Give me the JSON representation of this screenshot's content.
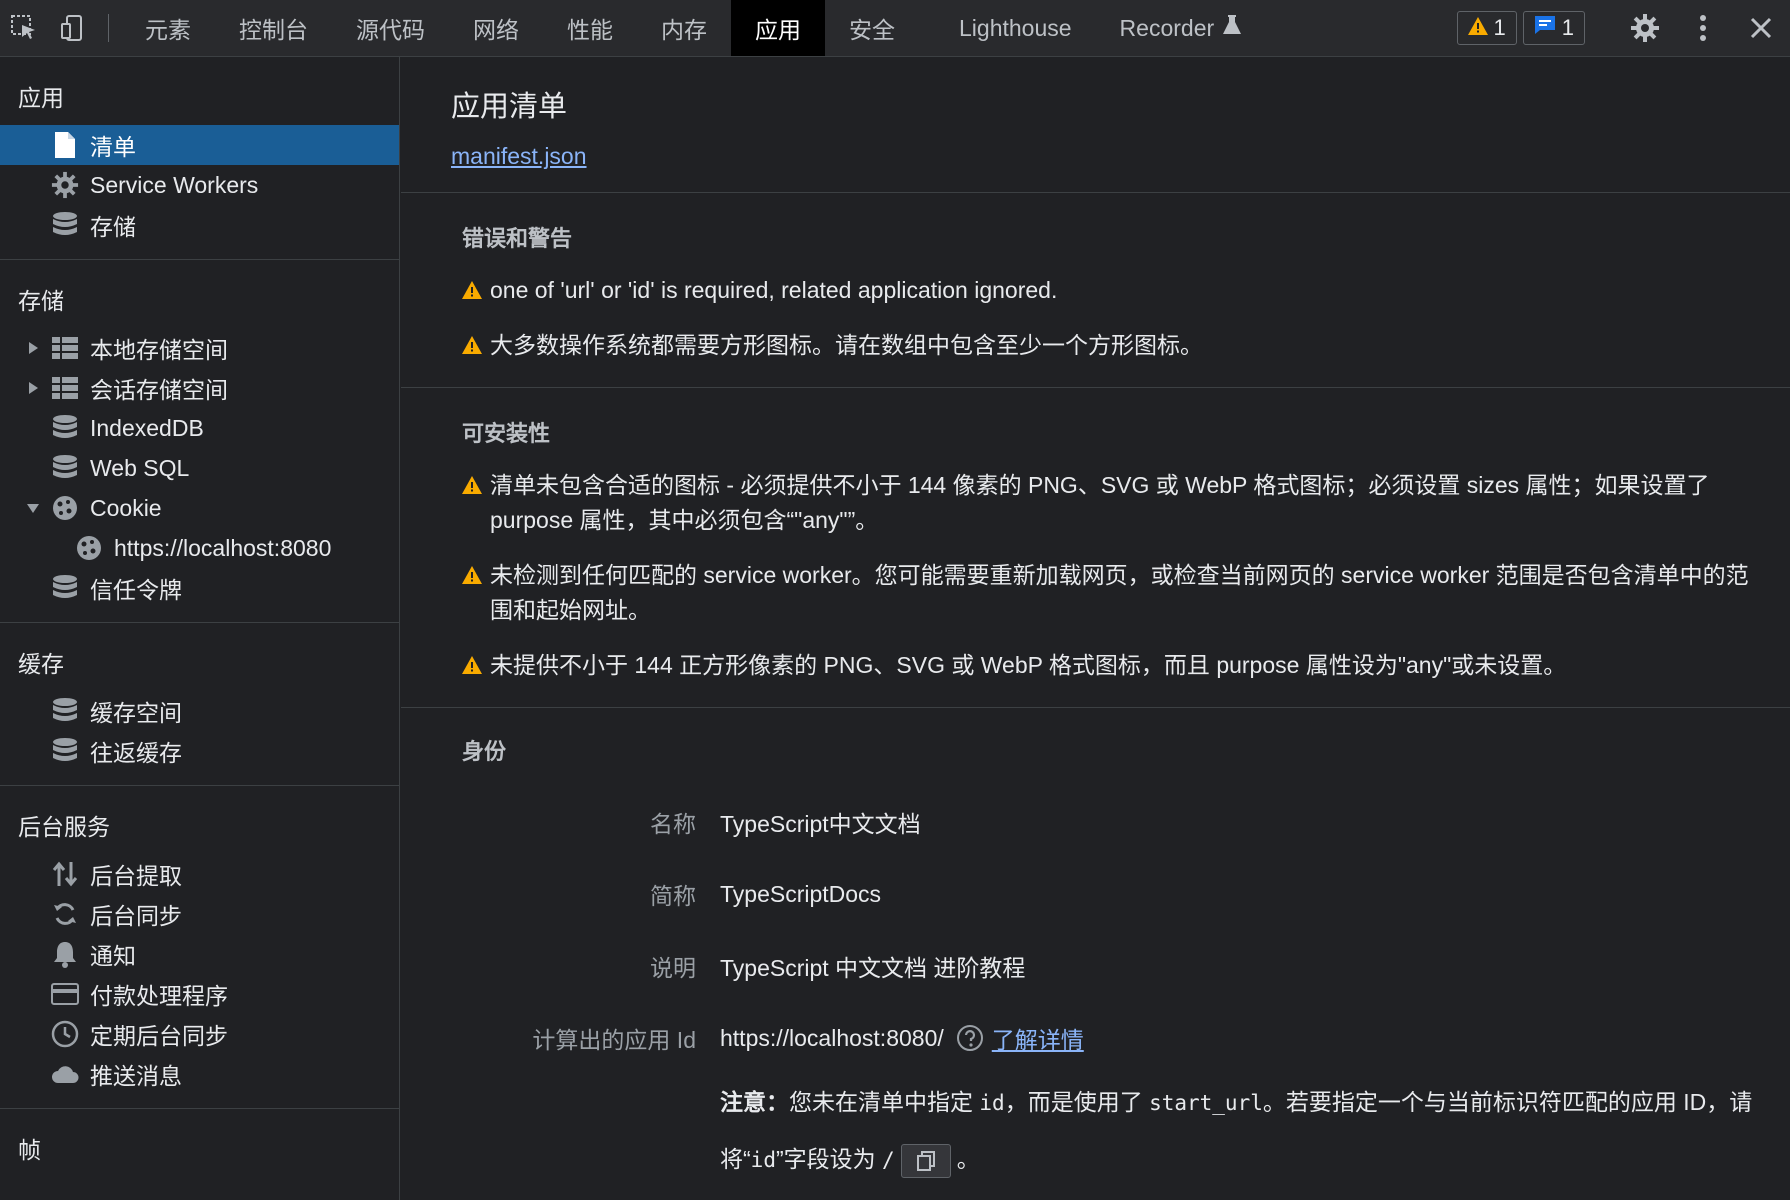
{
  "toolbar": {
    "tabs": [
      {
        "label": "元素"
      },
      {
        "label": "控制台"
      },
      {
        "label": "源代码"
      },
      {
        "label": "网络"
      },
      {
        "label": "性能"
      },
      {
        "label": "内存"
      },
      {
        "label": "应用"
      },
      {
        "label": "安全"
      },
      {
        "label": "Lighthouse"
      },
      {
        "label": "Recorder"
      }
    ],
    "warning_count": "1",
    "message_count": "1"
  },
  "sidebar": {
    "app": {
      "title": "应用",
      "items": [
        {
          "label": "清单"
        },
        {
          "label": "Service Workers"
        },
        {
          "label": "存储"
        }
      ]
    },
    "storage": {
      "title": "存储",
      "items": [
        {
          "label": "本地存储空间"
        },
        {
          "label": "会话存储空间"
        },
        {
          "label": "IndexedDB"
        },
        {
          "label": "Web SQL"
        },
        {
          "label": "Cookie"
        },
        {
          "label": "https://localhost:8080"
        },
        {
          "label": "信任令牌"
        }
      ]
    },
    "cache": {
      "title": "缓存",
      "items": [
        {
          "label": "缓存空间"
        },
        {
          "label": "往返缓存"
        }
      ]
    },
    "background": {
      "title": "后台服务",
      "items": [
        {
          "label": "后台提取"
        },
        {
          "label": "后台同步"
        },
        {
          "label": "通知"
        },
        {
          "label": "付款处理程序"
        },
        {
          "label": "定期后台同步"
        },
        {
          "label": "推送消息"
        }
      ]
    },
    "frames": {
      "title": "帧"
    }
  },
  "main": {
    "title": "应用清单",
    "manifest_link": "manifest.json",
    "errors": {
      "title": "错误和警告",
      "items": [
        "one of 'url' or 'id' is required, related application ignored.",
        "大多数操作系统都需要方形图标。请在数组中包含至少一个方形图标。"
      ]
    },
    "installability": {
      "title": "可安装性",
      "items": [
        "清单未包含合适的图标 - 必须提供不小于 144 像素的 PNG、SVG 或 WebP 格式图标；必须设置 sizes 属性；如果设置了 purpose 属性，其中必须包含“\"any\"”。",
        "未检测到任何匹配的 service worker。您可能需要重新加载网页，或检查当前网页的 service worker 范围是否包含清单中的范围和起始网址。",
        "未提供不小于 144 正方形像素的 PNG、SVG 或 WebP 格式图标，而且 purpose 属性设为\"any\"或未设置。"
      ]
    },
    "identity": {
      "title": "身份",
      "name_label": "名称",
      "name_value": "TypeScript中文文档",
      "short_name_label": "简称",
      "short_name_value": "TypeScriptDocs",
      "description_label": "说明",
      "description_value": "TypeScript 中文文档 进阶教程",
      "app_id_label": "计算出的应用 Id",
      "app_id_value": "https://localhost:8080/",
      "learn_more": "了解详情",
      "note_label": "注意：",
      "note_text_1": "您未在清单中指定 ",
      "note_code_1": "id",
      "note_text_2": "，而是使用了 ",
      "note_code_2": "start_url",
      "note_text_3": "。若要指定一个与当前标识符匹配的应用 ID，请将“",
      "note_code_3": "id",
      "note_text_4": "”字段设为 ",
      "note_code_4": "/",
      "note_text_5": "。"
    }
  },
  "colors": {
    "accent": "#1a5e96",
    "link": "#8ab4f8",
    "warning": "#f9ab00",
    "info": "#1a73e8"
  }
}
